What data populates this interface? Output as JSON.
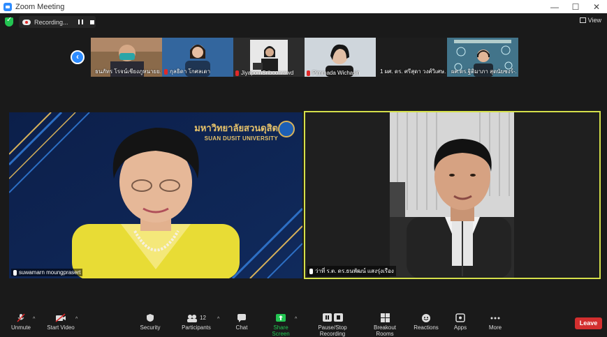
{
  "window": {
    "title": "Zoom Meeting",
    "minimize": "—",
    "maximize": "☐",
    "close": "✕"
  },
  "recording": {
    "label": "Recording..."
  },
  "view": {
    "label": "View"
  },
  "thumbnails": [
    {
      "name": "ธนภัทร โรจน์เชียงภูหนายย...",
      "bg": "#8a6a4a"
    },
    {
      "name": "กุลธิดา โกศลเดา",
      "bg": "#2d5b8f"
    },
    {
      "name": "JiyapornSriboonrawd",
      "bg": "#3c3c3c"
    },
    {
      "name": "Pimmada Wichasin",
      "bg": "#cfd6dc"
    },
    {
      "name": "1 ผศ. ดร. ศรีสุดา วงศ์วิเศษ...",
      "bg": "#1d1d1d"
    },
    {
      "name": "ผศ.ดร.ฐิติมาภา สุดนัยชงร์-...",
      "bg": "#3a5a70"
    }
  ],
  "main_videos": [
    {
      "name": "suwamarn moungprasert",
      "banner_th": "มหาวิทยาลัยสวนดุสิต",
      "banner_en": "SUAN DUSIT UNIVERSITY"
    },
    {
      "name": "ว่าที่ ร.ต. ดร.ธนพัฒน์ แสงรุ่งเรือง"
    }
  ],
  "toolbar": {
    "unmute": "Unmute",
    "start_video": "Start Video",
    "security": "Security",
    "participants": "Participants",
    "participants_count": "12",
    "chat": "Chat",
    "share_screen": "Share Screen",
    "pause_stop_recording": "Pause/Stop Recording",
    "breakout_rooms": "Breakout Rooms",
    "reactions": "Reactions",
    "apps": "Apps",
    "more": "More",
    "leave": "Leave"
  },
  "colors": {
    "accent": "#2d8cff",
    "share_green": "#23c552",
    "leave_red": "#d32f2f",
    "speaker_border": "#d5e04a"
  }
}
